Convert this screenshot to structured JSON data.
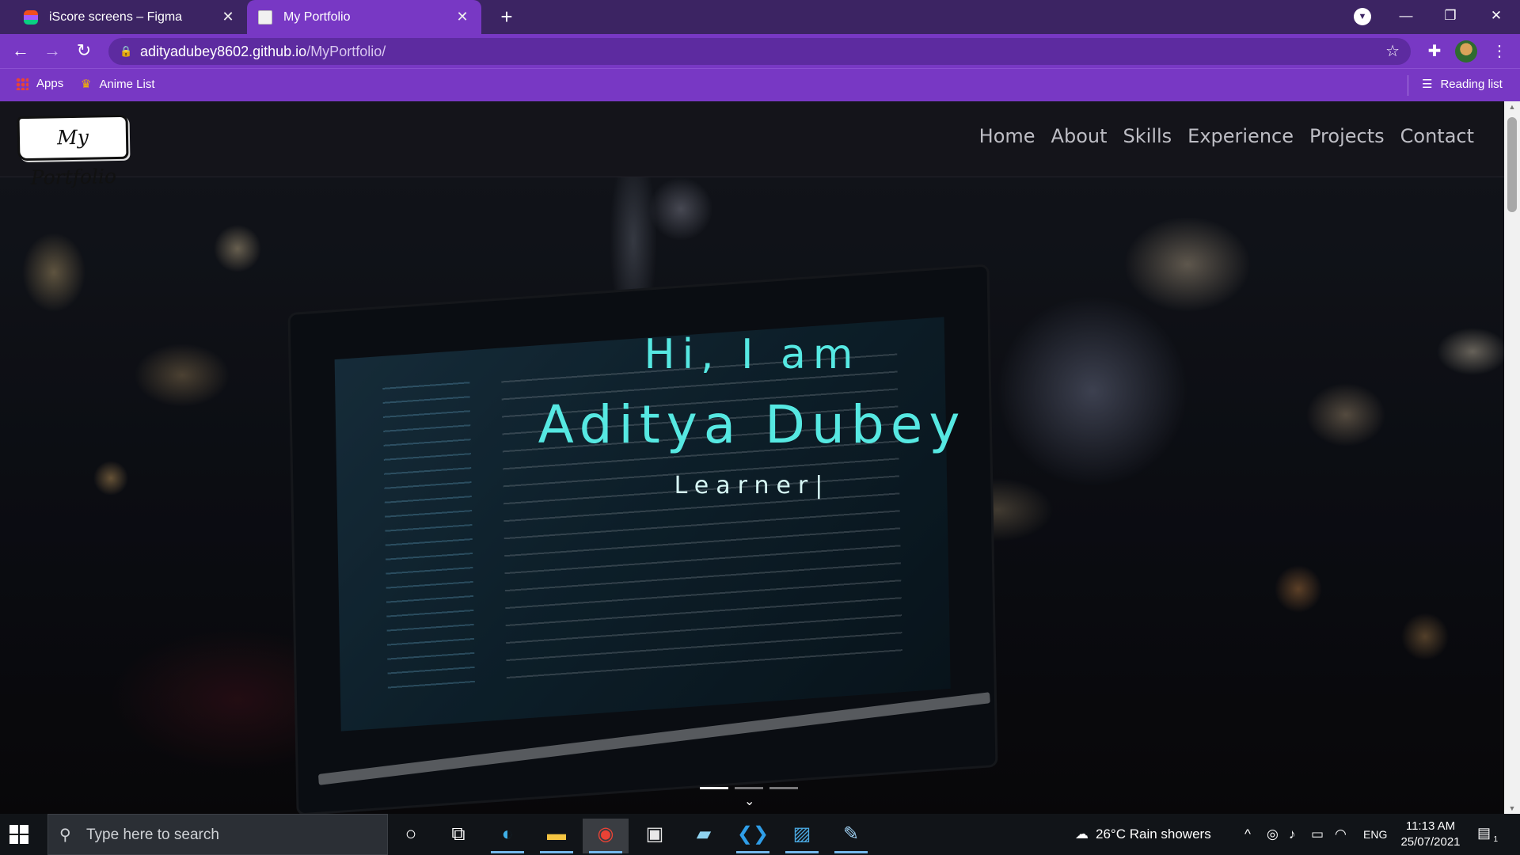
{
  "browser": {
    "tabs": [
      {
        "title": "iScore screens – Figma",
        "active": false,
        "favicon": "figma-icon"
      },
      {
        "title": "My Portfolio",
        "active": true,
        "favicon": "page-icon"
      }
    ],
    "new_tab_icon": "plus-icon",
    "address": {
      "host": "adityadubey8602.github.io",
      "path": "/MyPortfolio/"
    },
    "bookmarks": [
      {
        "label": "Apps",
        "icon": "apps-grid-icon"
      },
      {
        "label": "Anime List",
        "icon": "crown-icon"
      }
    ],
    "reading_list": "Reading list",
    "accent_color": "#7838c4",
    "tabstrip_color": "#3c2463"
  },
  "site": {
    "logo_text": "My Portfolio",
    "nav": [
      "Home",
      "About",
      "Skills",
      "Experience",
      "Projects",
      "Contact"
    ],
    "hero": {
      "greeting": "Hi, I am",
      "name": "Aditya Dubey",
      "role": "Learner|"
    },
    "carousel_active": 1,
    "carousel_count": 3,
    "accent_color": "#56e8e2"
  },
  "taskbar": {
    "search_placeholder": "Type here to search",
    "weather": "26°C  Rain showers",
    "language": "ENG",
    "time": "11:13 AM",
    "date": "25/07/2021",
    "notification_count": "1"
  }
}
